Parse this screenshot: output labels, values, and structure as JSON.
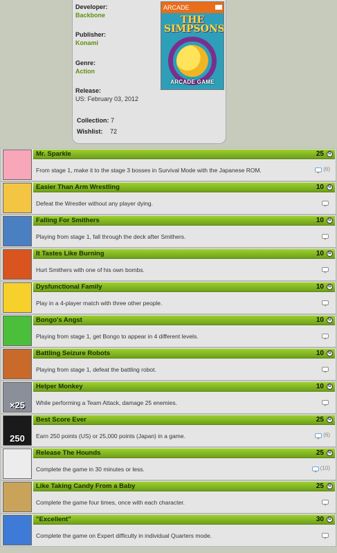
{
  "game_info": {
    "developer_label": "Developer:",
    "developer": "Backbone",
    "publisher_label": "Publisher:",
    "publisher": "Konami",
    "genre_label": "Genre:",
    "genre": "Action",
    "release_label": "Release:",
    "release": "US: February 03, 2012",
    "collection_label": "Collection:",
    "collection": "7",
    "wishlist_label": "Wishlist:",
    "wishlist": "72",
    "cover": {
      "platform_banner": "ARCADE",
      "title": "THE SIMPSONS",
      "subtitle": "ARCADE GAME",
      "icon": "game-cover-art"
    }
  },
  "colors": {
    "accent_green": "#5f8f12",
    "bar_green_top": "#9dd12d",
    "bar_green_bottom": "#6ea01a",
    "card_bg": "#e3e3e3",
    "page_bg": "#c7cbbc"
  },
  "achievements": [
    {
      "name": "Mr. Sparkle",
      "score": "25",
      "description": "From stage 1, make it to the stage 3 bosses in Survival Mode with the Japanese ROM.",
      "comments": "(6)",
      "thumb_color": "#f7a7b8",
      "thumb_label": ""
    },
    {
      "name": "Easier Than Arm Wrestling",
      "score": "10",
      "description": "Defeat the Wrestler without any player dying.",
      "comments": "",
      "thumb_color": "#f4c542",
      "thumb_label": ""
    },
    {
      "name": "Falling For Smithers",
      "score": "10",
      "description": "Playing from stage 1, fall through the deck after Smithers.",
      "comments": "",
      "thumb_color": "#4a7fc1",
      "thumb_label": ""
    },
    {
      "name": "It Tastes Like Burning",
      "score": "10",
      "description": "Hurt Smithers with one of his own bombs.",
      "comments": "",
      "thumb_color": "#d9541e",
      "thumb_label": ""
    },
    {
      "name": "Dysfunctional Family",
      "score": "10",
      "description": "Play in a 4-player match with three other people.",
      "comments": "",
      "thumb_color": "#f6d12b",
      "thumb_label": ""
    },
    {
      "name": "Bongo's Angst",
      "score": "10",
      "description": "Playing from stage 1, get Bongo to appear in 4 different levels.",
      "comments": "",
      "thumb_color": "#4bbf3c",
      "thumb_label": ""
    },
    {
      "name": "Battling Seizure Robots",
      "score": "10",
      "description": "Playing from stage 1, defeat the battling robot.",
      "comments": "",
      "thumb_color": "#c96a2b",
      "thumb_label": ""
    },
    {
      "name": "Helper Monkey",
      "score": "10",
      "description": "While performing a Team Attack, damage 25 enemies.",
      "comments": "",
      "thumb_color": "#8a8f99",
      "thumb_label": "×25"
    },
    {
      "name": "Best Score Ever",
      "score": "25",
      "description": "Earn 250 points (US) or 25,000 points (Japan) in a game.",
      "comments": "(6)",
      "thumb_color": "#1a1a1a",
      "thumb_label": "250"
    },
    {
      "name": "Release The Hounds",
      "score": "25",
      "description": "Complete the game in 30 minutes or less.",
      "comments": "(10)",
      "thumb_color": "#ececec",
      "thumb_label": ""
    },
    {
      "name": "Like Taking Candy From a Baby",
      "score": "25",
      "description": "Complete the game four times, once with each character.",
      "comments": "",
      "thumb_color": "#c9a35a",
      "thumb_label": ""
    },
    {
      "name": "\"Excellent\"",
      "score": "30",
      "description": "Complete the game on Expert difficulty in individual Quarters mode.",
      "comments": "",
      "thumb_color": "#3d7bd6",
      "thumb_label": ""
    }
  ]
}
